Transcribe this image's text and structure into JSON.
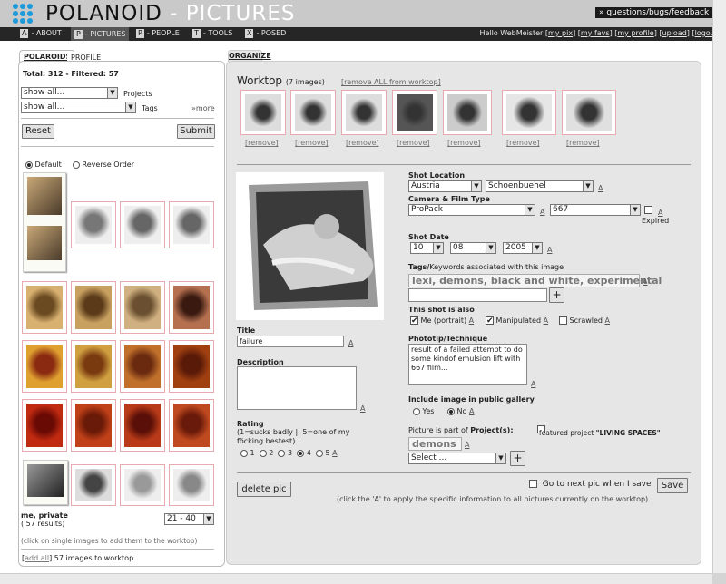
{
  "app": {
    "logo": "POLANOID",
    "logo_sub": " - PICTURES",
    "feedback": "» questions/bugs/feedback"
  },
  "nav": {
    "items": [
      {
        "key": "A",
        "label": "- ABOUT"
      },
      {
        "key": "P",
        "label": "- PICTURES"
      },
      {
        "key": "P",
        "label": "- PEOPLE"
      },
      {
        "key": "T",
        "label": "- TOOLS"
      },
      {
        "key": "X",
        "label": "- POSED"
      }
    ],
    "hello": "Hello WebMeister",
    "links": [
      "my pix",
      "my favs",
      "my profile",
      "upload",
      "logout"
    ]
  },
  "left": {
    "tabs": [
      "POLAROIDS",
      "PROFILE"
    ],
    "total": "Total: 312 - Filtered: 57",
    "projects_select": "show all...",
    "projects_label": "Projects",
    "tags_select": "show all...",
    "tags_label": "Tags",
    "more": "»more",
    "reset": "Reset",
    "submit": "Submit",
    "order_default": "Default",
    "order_reverse": "Reverse Order",
    "gallery_name": "me, private",
    "results": "( 57 results)",
    "range": "21 - 40",
    "hint": "(click on single images to add them to the worktop)",
    "add_all": "add all",
    "add_all_suffix": "57 images to worktop"
  },
  "organize": {
    "tab": "ORGANIZE",
    "worktop_title": "Worktop",
    "worktop_count": "(7 images)",
    "remove_all": "[remove ALL from worktop]",
    "remove_label": "[remove]",
    "shot_location": "Shot Location",
    "country": "Austria",
    "city": "Schoenbuehel",
    "camera_label": "Camera & Film Type",
    "camera": "ProPack",
    "film": "667",
    "expired": "Expired",
    "shot_date": "Shot Date",
    "day": "10",
    "month": "08",
    "year": "2005",
    "tags_label": "Tags/",
    "tags_label2": "Keywords associated with this image",
    "tags_value": "lexi, demons, black and white, experimental",
    "plus": "+",
    "also_label": "This shot is also",
    "me": "Me (portrait)",
    "manipulated": "Manipulated",
    "scrawled": "Scrawled",
    "phototip_label": "Phototip/Technique",
    "phototip": "result of a failed attempt to do some kindof emulsion lift with 667 film...",
    "public_label": "Include image in public gallery",
    "yes": "Yes",
    "no": "No",
    "project_label": "Picture is part of ",
    "project_label2": "Project(s):",
    "featured": "featured project ",
    "featured_name": "\"LIVING SPACES\"",
    "project_tag": "demons",
    "project_select": "Select ...",
    "title_label": "Title",
    "title_value": "failure",
    "desc_label": "Description",
    "rating_label": "Rating",
    "rating_text": "(1=sucks badly || 5=one of my föcking bestest)",
    "rating_opts": [
      "1",
      "2",
      "3",
      "4",
      "5"
    ],
    "delete": "delete pic",
    "next_label": "Go to next pic when I save",
    "save": "Save",
    "apply_hint": "(click the 'A' to apply the specific information to all pictures currently on the worktop)",
    "a": "A"
  }
}
